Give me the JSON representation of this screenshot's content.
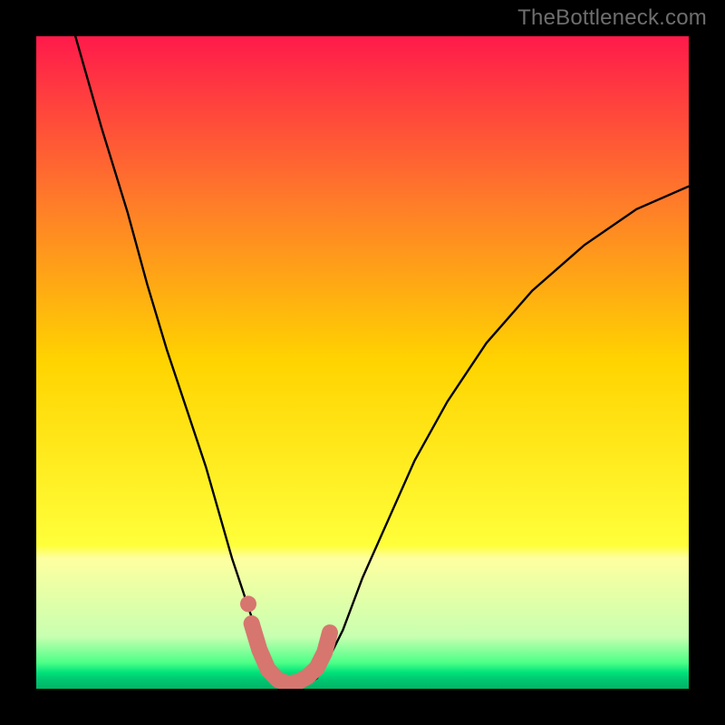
{
  "watermark": "TheBottleneck.com",
  "chart_data": {
    "type": "line",
    "title": "",
    "xlabel": "",
    "ylabel": "",
    "xlim": [
      0,
      100
    ],
    "ylim": [
      0,
      100
    ],
    "grid": false,
    "legend": false,
    "gradient_stops": [
      {
        "offset": 0.0,
        "color": "#ff1a4b"
      },
      {
        "offset": 0.25,
        "color": "#ff7a2a"
      },
      {
        "offset": 0.5,
        "color": "#ffd400"
      },
      {
        "offset": 0.78,
        "color": "#ffff3a"
      },
      {
        "offset": 0.8,
        "color": "#feffa0"
      },
      {
        "offset": 0.92,
        "color": "#c8ffb0"
      },
      {
        "offset": 0.96,
        "color": "#4dff88"
      },
      {
        "offset": 0.975,
        "color": "#00e27a"
      },
      {
        "offset": 0.985,
        "color": "#00c971"
      },
      {
        "offset": 1.0,
        "color": "#00b466"
      }
    ],
    "series": [
      {
        "name": "bottleneck-curve",
        "x": [
          6,
          10,
          14,
          17,
          20,
          23,
          26,
          28,
          30,
          32,
          34,
          35.5,
          37,
          39,
          41,
          43,
          44.5,
          47,
          50,
          54,
          58,
          63,
          69,
          76,
          84,
          92,
          100
        ],
        "y": [
          100,
          86,
          73,
          62,
          52,
          43,
          34,
          27,
          20,
          14,
          8,
          4,
          1.6,
          0.4,
          0.4,
          1.6,
          4,
          9,
          17,
          26,
          35,
          44,
          53,
          61,
          68,
          73.5,
          77
        ]
      }
    ],
    "highlight_band": {
      "name": "optimal-range",
      "color": "#d6766f",
      "x": [
        33.0,
        34.2,
        35.5,
        37.0,
        38.5,
        40.0,
        41.5,
        43.0,
        44.2,
        45.0
      ],
      "y": [
        10.0,
        6.0,
        3.0,
        1.4,
        0.8,
        1.0,
        1.8,
        3.2,
        5.6,
        8.6
      ]
    },
    "highlight_dot": {
      "name": "marker-dot",
      "color": "#d6766f",
      "x": 32.5,
      "y": 13.0
    }
  }
}
